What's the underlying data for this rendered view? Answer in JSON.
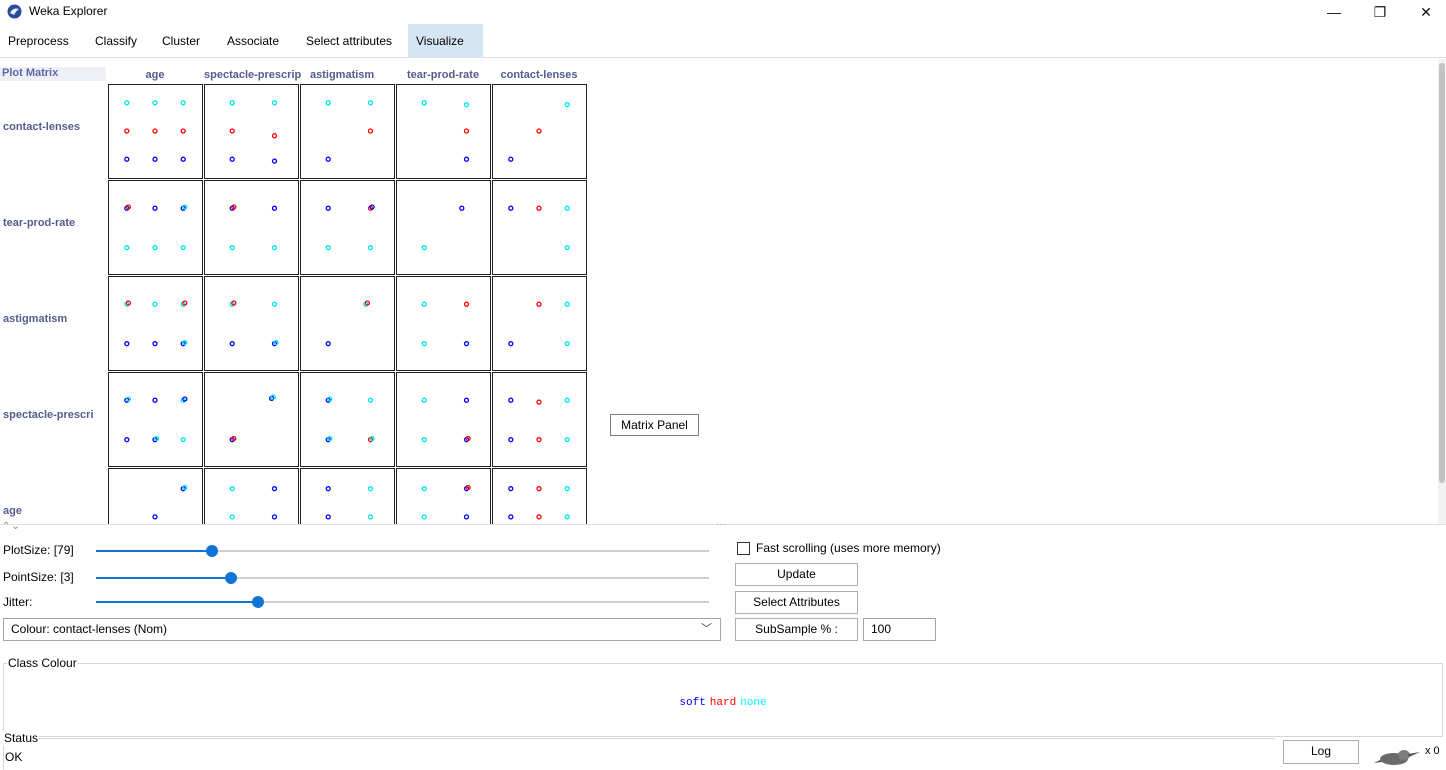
{
  "window": {
    "title": "Weka Explorer",
    "minimize_glyph": "—",
    "restore_glyph": "❐",
    "close_glyph": "✕"
  },
  "tabs": [
    {
      "label": "Preprocess"
    },
    {
      "label": "Classify"
    },
    {
      "label": "Cluster"
    },
    {
      "label": "Associate"
    },
    {
      "label": "Select attributes"
    },
    {
      "label": "Visualize",
      "active": true
    }
  ],
  "matrix": {
    "title": "Plot Matrix",
    "columns": [
      "age",
      "spectacle-prescrip",
      "astigmatism",
      "tear-prod-rate",
      "contact-lenses"
    ],
    "rows": [
      "contact-lenses",
      "tear-prod-rate",
      "astigmatism",
      "spectacle-prescri",
      "age"
    ],
    "class_colors": {
      "soft": "#0000ff",
      "hard": "#ff0000",
      "none": "#00e6e6"
    },
    "tooltip": "Matrix Panel"
  },
  "controls": {
    "plot_size_label": "PlotSize: [79]",
    "plot_size_value": 0.19,
    "point_size_label": "PointSize: [3]",
    "point_size_value": 0.22,
    "jitter_label": "Jitter:",
    "jitter_value": 0.265,
    "fast_scrolling_label": "Fast scrolling (uses more memory)",
    "fast_scrolling_checked": false,
    "update_label": "Update",
    "select_attributes_label": "Select Attributes",
    "colour_select": "Colour: contact-lenses  (Nom)",
    "subsample_label": "SubSample % :",
    "subsample_value": "100"
  },
  "class_colour": {
    "legend": "Class Colour",
    "classes": [
      {
        "name": "soft",
        "color": "#0000ff"
      },
      {
        "name": "hard",
        "color": "#ff0000"
      },
      {
        "name": "none",
        "color": "#00ffff"
      }
    ]
  },
  "status": {
    "legend": "Status",
    "text": "OK",
    "log_label": "Log",
    "count": "x 0"
  }
}
